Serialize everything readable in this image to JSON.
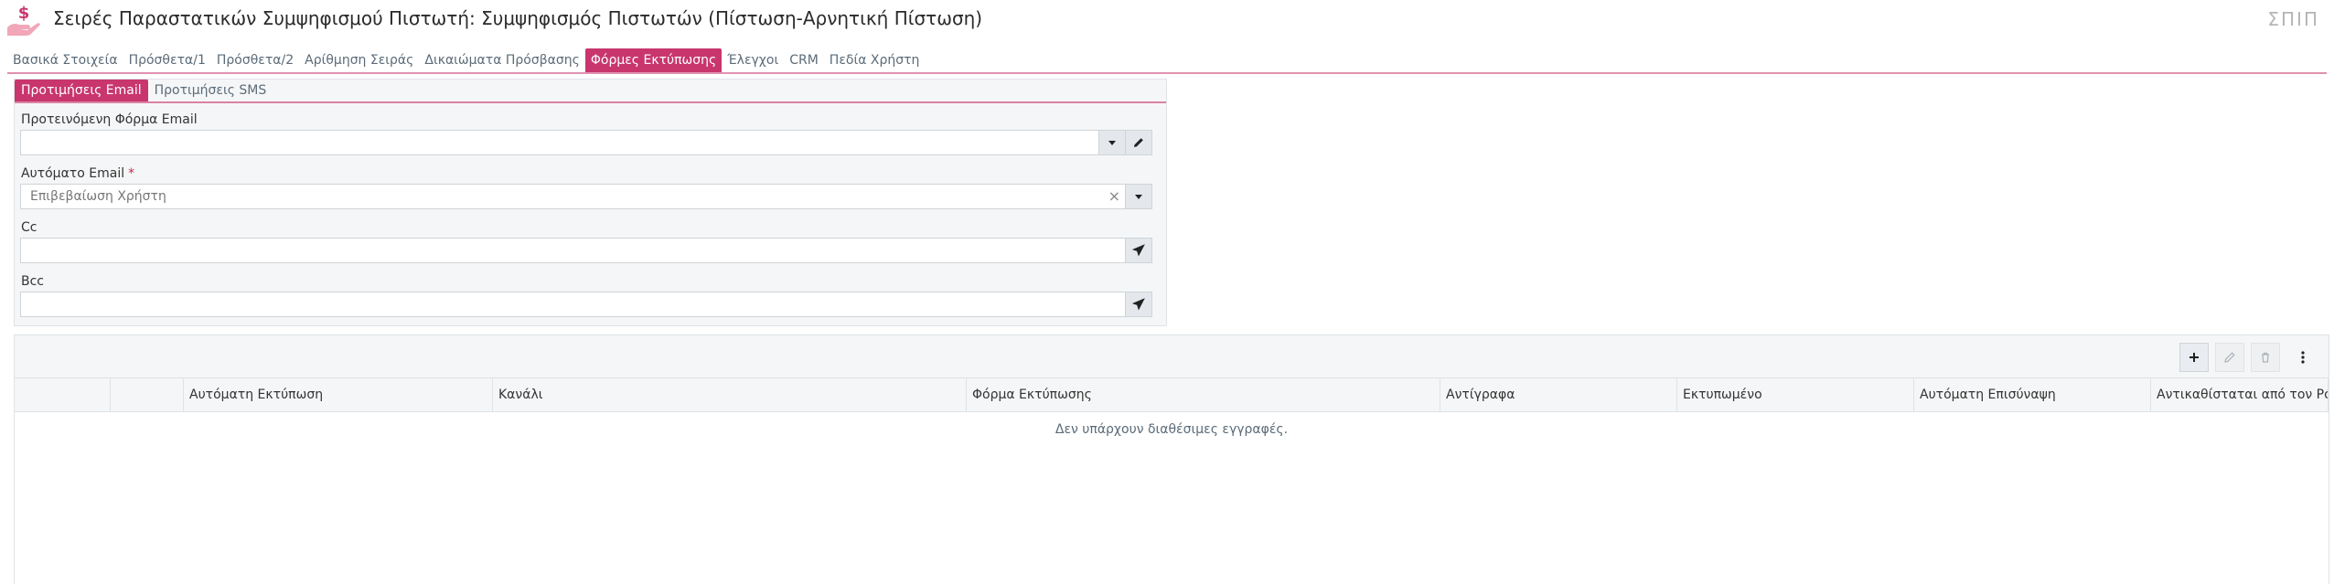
{
  "header": {
    "title": "Σειρές Παραστατικών Συμψηφισμού Πιστωτή: Συμψηφισμός Πιστωτών (Πίστωση-Αρνητική Πίστωση)",
    "user_tag": "ΣΠΙΠ",
    "icon": "dollar-hand-icon"
  },
  "tabs": [
    {
      "label": "Βασικά Στοιχεία"
    },
    {
      "label": "Πρόσθετα/1"
    },
    {
      "label": "Πρόσθετα/2"
    },
    {
      "label": "Αρίθμηση Σειράς"
    },
    {
      "label": "Δικαιώματα Πρόσβασης"
    },
    {
      "label": "Φόρμες Εκτύπωσης",
      "active": true
    },
    {
      "label": "Έλεγχοι"
    },
    {
      "label": "CRM"
    },
    {
      "label": "Πεδία Χρήστη"
    }
  ],
  "subtabs": [
    {
      "label": "Προτιμήσεις Email",
      "active": true
    },
    {
      "label": "Προτιμήσεις SMS"
    }
  ],
  "email_form": {
    "suggested_form": {
      "label": "Προτεινόμενη Φόρμα Email",
      "value": ""
    },
    "auto_email": {
      "label": "Αυτόματο Email",
      "required_mark": "*",
      "value": "Επιβεβαίωση Χρήστη"
    },
    "cc": {
      "label": "Cc",
      "value": ""
    },
    "bcc": {
      "label": "Bcc",
      "value": ""
    }
  },
  "grid": {
    "columns": [
      {
        "label": ""
      },
      {
        "label": ""
      },
      {
        "label": "Αυτόματη Εκτύπωση"
      },
      {
        "label": "Κανάλι"
      },
      {
        "label": "Φόρμα Εκτύπωσης"
      },
      {
        "label": "Αντίγραφα"
      },
      {
        "label": "Εκτυπωμένο"
      },
      {
        "label": "Αυτόματη Επισύναψη"
      },
      {
        "label": "Αντικαθίσταται από τον Ρόλο."
      }
    ],
    "empty_message": "Δεν υπάρχουν διαθέσιμες εγγραφές.",
    "toolbar": [
      "add-icon",
      "edit-icon",
      "delete-icon",
      "more-vertical-icon"
    ]
  },
  "colors": {
    "accent": "#c8366d",
    "icon_bg": "#f2a7b8"
  }
}
